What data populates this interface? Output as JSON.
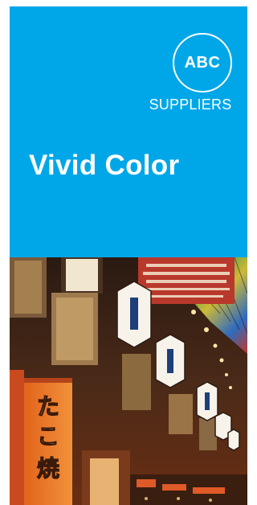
{
  "brochure": {
    "background_color": "#00a7e8",
    "logo_text": "ABC",
    "company_name": "SUPPLIERS",
    "headline": "Vivid Color",
    "photo_subject": "night market street with hanging signs and lanterns",
    "sign_text": "たこ焼"
  }
}
